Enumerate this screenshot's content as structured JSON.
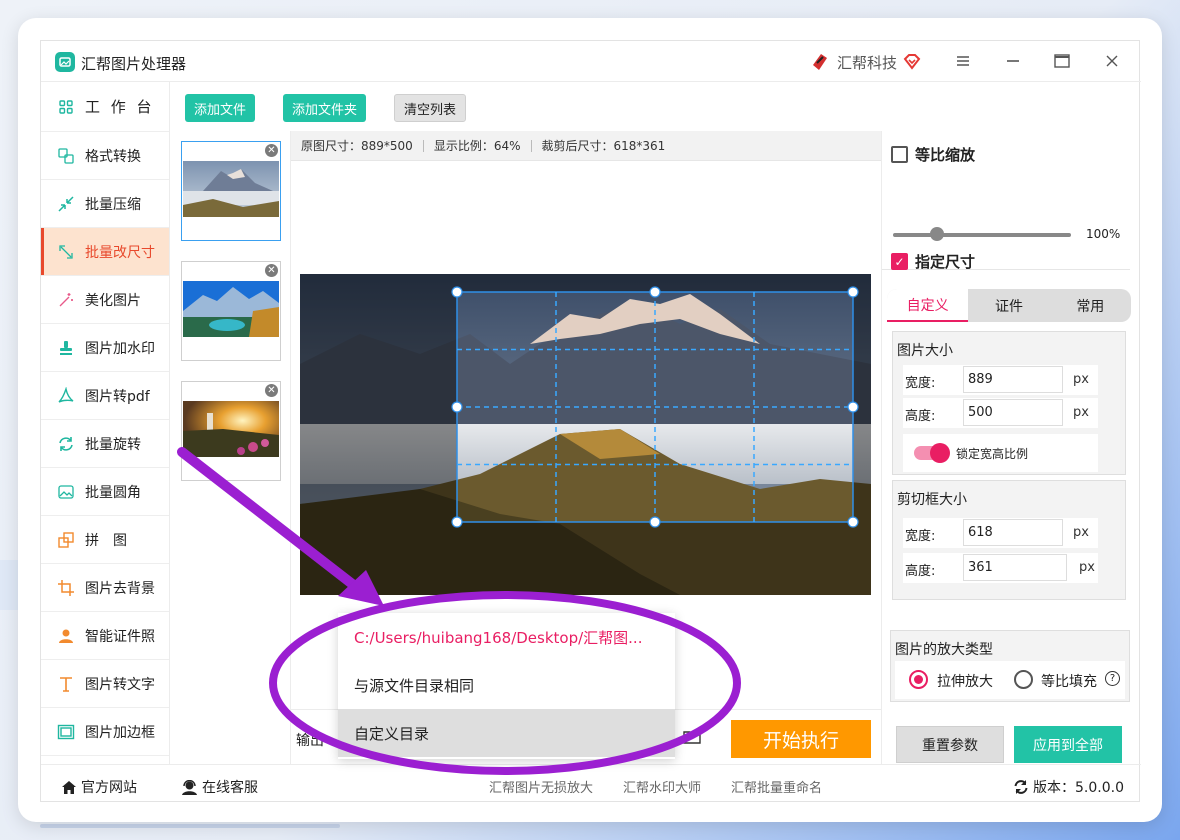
{
  "app": {
    "title": "汇帮图片处理器",
    "brand": "汇帮科技"
  },
  "sidebar": {
    "items": [
      {
        "label": "工 作 台",
        "icon": "grid-icon"
      },
      {
        "label": "格式转换",
        "icon": "format-convert-icon"
      },
      {
        "label": "批量压缩",
        "icon": "compress-icon"
      },
      {
        "label": "批量改尺寸",
        "icon": "resize-icon",
        "active": true
      },
      {
        "label": "美化图片",
        "icon": "beautify-icon"
      },
      {
        "label": "图片加水印",
        "icon": "watermark-icon"
      },
      {
        "label": "图片转pdf",
        "icon": "pdf-icon"
      },
      {
        "label": "批量旋转",
        "icon": "rotate-icon"
      },
      {
        "label": "批量圆角",
        "icon": "rounded-corner-icon"
      },
      {
        "label": "拼　图",
        "icon": "puzzle-icon"
      },
      {
        "label": "图片去背景",
        "icon": "crop-icon"
      },
      {
        "label": "智能证件照",
        "icon": "person-icon"
      },
      {
        "label": "图片转文字",
        "icon": "text-icon"
      },
      {
        "label": "图片加边框",
        "icon": "frame-icon"
      }
    ]
  },
  "toolbar": {
    "add_file": "添加文件",
    "add_folder": "添加文件夹",
    "clear_list": "清空列表"
  },
  "info": {
    "original_size": "原图尺寸：889*500",
    "display_ratio": "显示比例：64%",
    "cropped_size": "裁剪后尺寸：618*361"
  },
  "right": {
    "proportional": "等比缩放",
    "scale_value": "100%",
    "scale_fraction": 0.25,
    "specify_size": "指定尺寸",
    "tabs": [
      "自定义",
      "证件",
      "常用"
    ],
    "image_size_title": "图片大小",
    "width_label": "宽度:",
    "height_label": "高度:",
    "image_width": "889",
    "image_height": "500",
    "unit": "px",
    "lock_ratio": "锁定宽高比例",
    "crop_size_title": "剪切框大小",
    "crop_width": "618",
    "crop_height": "361",
    "zoom_type_title": "图片的放大类型",
    "stretch": "拉伸放大",
    "fill": "等比填充",
    "help": "?",
    "reset": "重置参数",
    "apply_all": "应用到全部"
  },
  "output": {
    "label": "输出",
    "start": "开始执行"
  },
  "dropdown": {
    "items": [
      "C:/Users/huibang168/Desktop/汇帮图...",
      "与源文件目录相同",
      "自定义目录"
    ]
  },
  "footer": {
    "website": "官方网站",
    "service": "在线客服",
    "link1": "汇帮图片无损放大",
    "link2": "汇帮水印大师",
    "link3": "汇帮批量重命名",
    "version": "版本：5.0.0.0"
  },
  "colors": {
    "accent_teal": "#22c3a6",
    "accent_pink": "#e91e63",
    "accent_orange": "#ff9800",
    "active_side": "#e8492c",
    "annotation_purple": "#9b1fd1"
  }
}
